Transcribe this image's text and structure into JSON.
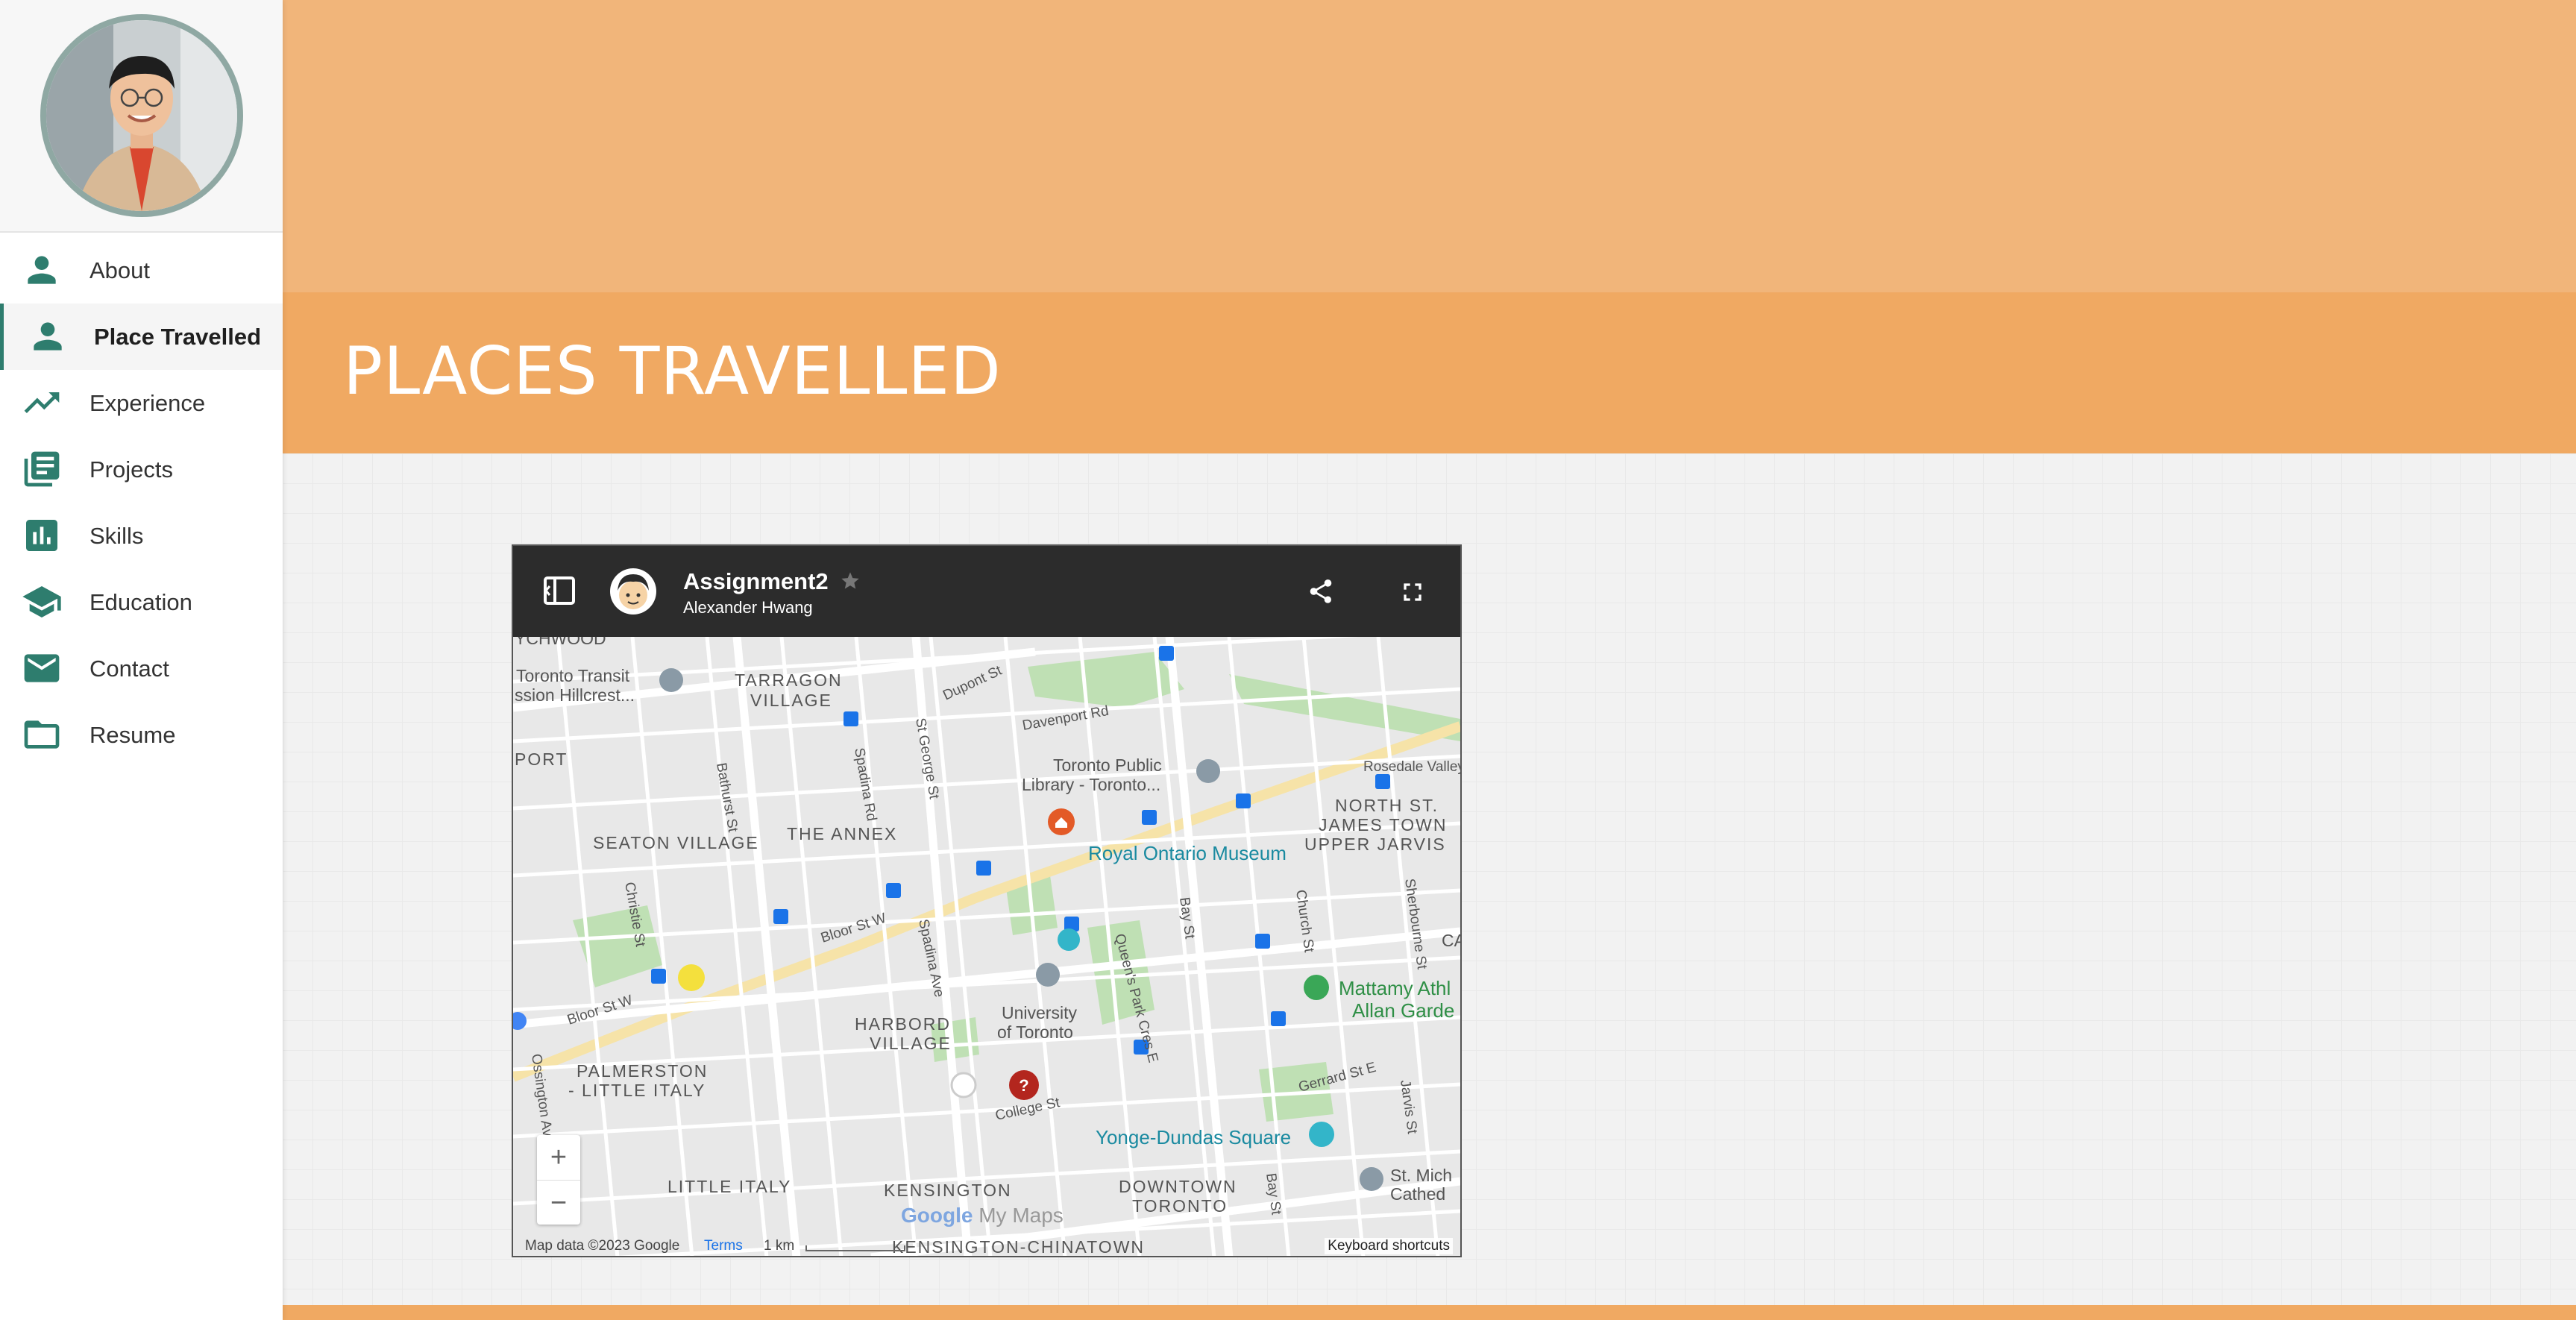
{
  "nav": {
    "items": [
      {
        "label": "About",
        "icon": "person-icon",
        "active": false
      },
      {
        "label": "Place Travelled",
        "icon": "person-icon",
        "active": true
      },
      {
        "label": "Experience",
        "icon": "trending-up-icon",
        "active": false
      },
      {
        "label": "Projects",
        "icon": "library-books-icon",
        "active": false
      },
      {
        "label": "Skills",
        "icon": "bar-chart-icon",
        "active": false
      },
      {
        "label": "Education",
        "icon": "school-icon",
        "active": false
      },
      {
        "label": "Contact",
        "icon": "email-icon",
        "active": false
      },
      {
        "label": "Resume",
        "icon": "folder-icon",
        "active": false
      }
    ]
  },
  "hero": {
    "title": "PLACES TRAVELLED"
  },
  "map": {
    "title": "Assignment2",
    "author": "Alexander Hwang",
    "labels": {
      "ychwood": "YCHWOOD",
      "tarragon1": "TARRAGON",
      "tarragon2": "VILLAGE",
      "transit1": "Toronto Transit",
      "transit2": "ssion Hillcrest...",
      "dupont": "Dupont St",
      "davenport": "Davenport Rd",
      "port": "PORT",
      "library1": "Toronto Public",
      "library2": "Library - Toronto...",
      "rosedale": "Rosedale Valley",
      "northst1": "NORTH ST.",
      "northst2": "JAMES TOWN",
      "upperjarvis": "UPPER JARVIS",
      "seaton": "SEATON VILLAGE",
      "annex": "THE ANNEX",
      "rom": "Royal Ontario Museum",
      "bathurst": "Bathurst St",
      "spadina_rd": "Spadina Rd",
      "stgeorge": "St George St",
      "christie": "Christie St",
      "bloor_w": "Bloor St W",
      "bloor_w2": "Bloor St W",
      "spadina_ave": "Spadina Ave",
      "bay": "Bay St",
      "church": "Church St",
      "sherbourne": "Sherbourne St",
      "queenspark": "Queen's Park Cres E",
      "harbord1": "HARBORD",
      "harbord2": "VILLAGE",
      "uoft1": "University",
      "uoft2": "of Toronto",
      "mattamy1": "Mattamy Athl",
      "mattamy2": "Allan Garde",
      "ca": "CA",
      "palmerston1": "PALMERSTON",
      "palmerston2": "- LITTLE ITALY",
      "ossington": "Ossington Ave",
      "college": "College St",
      "gerrard": "Gerrard St E",
      "jarvis": "Jarvis St",
      "yonge_dundas": "Yonge-Dundas Square",
      "stmich1": "St. Mich",
      "stmich2": "Cathed",
      "little_italy": "LITTLE ITALY",
      "kensington": "KENSINGTON",
      "downtown1": "DOWNTOWN",
      "downtown2": "TORONTO",
      "kensington_china": "KENSINGTON-CHINATOWN",
      "bay2": "Bay St"
    },
    "footer": {
      "data": "Map data ©2023 Google",
      "terms": "Terms",
      "scale": "1 km",
      "keyboard": "Keyboard shortcuts"
    },
    "branding": {
      "google": "Google",
      "mymaps": "My Maps"
    },
    "zoom_in": "+",
    "zoom_out": "−"
  },
  "colors": {
    "accent": "#2e7d6e",
    "hero_light": "#f1b57a",
    "hero_dark": "#f0a962"
  }
}
